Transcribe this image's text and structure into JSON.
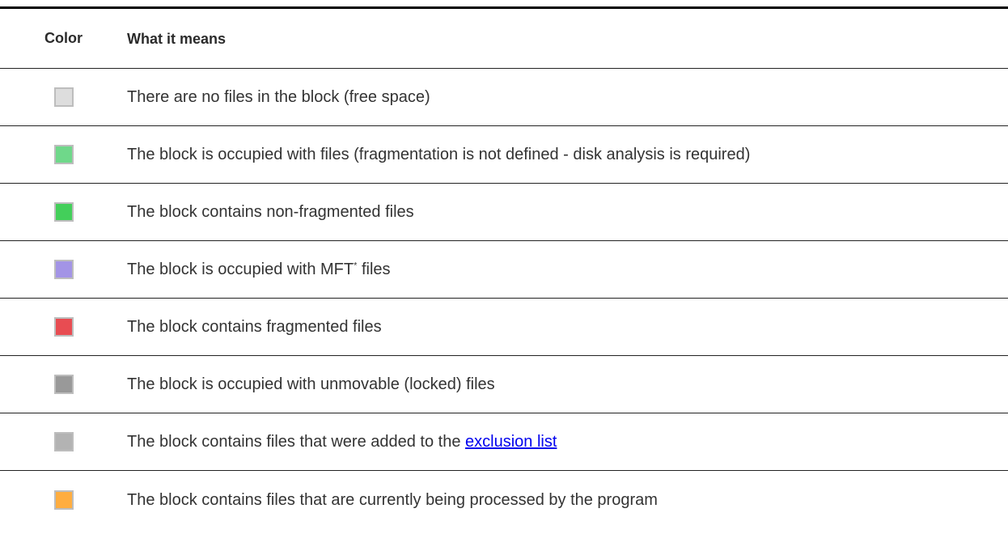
{
  "table": {
    "headers": {
      "color": "Color",
      "meaning": "What it means"
    },
    "rows": [
      {
        "color": "#dddddd",
        "text": "There are no files in the block (free space)"
      },
      {
        "color": "#6fd88a",
        "text": "The block is occupied with files (fragmentation is not defined - disk analysis is required)"
      },
      {
        "color": "#43cf5a",
        "text": "The block contains non-fragmented files"
      },
      {
        "color": "#a394e6",
        "text_before": "The block is occupied with MFT",
        "sup": "*",
        "text_after": " files"
      },
      {
        "color": "#e84c52",
        "text": "The block contains fragmented files"
      },
      {
        "color": "#999999",
        "text": "The block is occupied with unmovable (locked) files"
      },
      {
        "color": "#b3b3b3",
        "text_before": "The block contains files that were added to the ",
        "link": "exclusion list"
      },
      {
        "color": "#ffad3f",
        "text": "The block contains files that are currently being processed by the program"
      }
    ]
  }
}
